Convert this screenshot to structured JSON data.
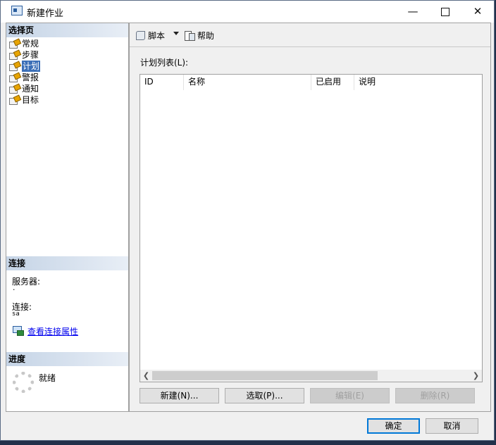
{
  "window": {
    "title": "新建作业",
    "minimize": "—",
    "close": "✕"
  },
  "sidebar": {
    "select_page_header": "选择页",
    "pages": [
      {
        "label": "常规",
        "selected": false
      },
      {
        "label": "步骤",
        "selected": false
      },
      {
        "label": "计划",
        "selected": true
      },
      {
        "label": "警报",
        "selected": false
      },
      {
        "label": "通知",
        "selected": false
      },
      {
        "label": "目标",
        "selected": false
      }
    ],
    "connection_header": "连接",
    "server_label": "服务器:",
    "server_value": ".",
    "connection_label": "连接:",
    "connection_value": "sa",
    "view_connection_link": "查看连接属性",
    "progress_header": "进度",
    "progress_status": "就绪"
  },
  "toolbar": {
    "script_label": "脚本",
    "help_label": "帮助"
  },
  "schedule": {
    "list_label": "计划列表(L):",
    "columns": [
      "ID",
      "名称",
      "已启用",
      "说明"
    ],
    "rows": []
  },
  "actions": {
    "new": "新建(N)...",
    "pick": "选取(P)...",
    "edit": "编辑(E)",
    "delete": "删除(R)"
  },
  "footer": {
    "ok": "确定",
    "cancel": "取消"
  },
  "colors": {
    "selection": "#3b6fb7",
    "link": "#0000ee",
    "default_border": "#0078d7"
  }
}
